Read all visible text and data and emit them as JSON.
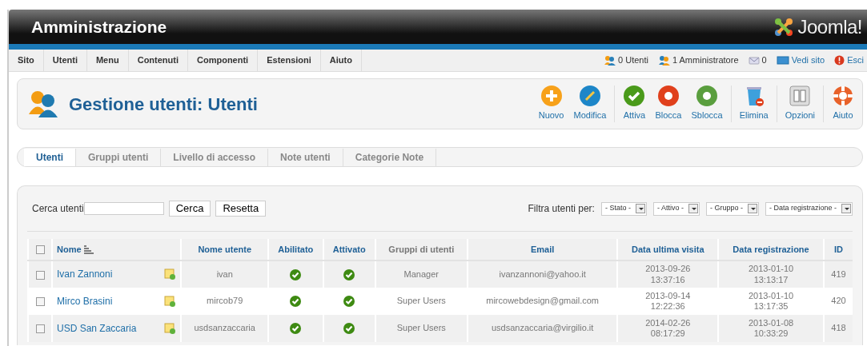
{
  "header": {
    "title": "Amministrazione",
    "logo_text": "Joomla!"
  },
  "menu": [
    "Sito",
    "Utenti",
    "Menu",
    "Contenuti",
    "Componenti",
    "Estensioni",
    "Aiuto"
  ],
  "status": [
    {
      "kind": "users",
      "text": "0 Utenti"
    },
    {
      "kind": "admins",
      "text": "1 Amministratore"
    },
    {
      "kind": "messages",
      "text": "0"
    },
    {
      "kind": "view",
      "text": "Vedi sito"
    },
    {
      "kind": "logout",
      "text": "Esci"
    }
  ],
  "toolbar": {
    "title": "Gestione utenti: Utenti",
    "groups": [
      {
        "buttons": [
          {
            "kind": "new",
            "label": "Nuovo"
          },
          {
            "kind": "edit",
            "label": "Modifica"
          }
        ]
      },
      {
        "buttons": [
          {
            "kind": "activate",
            "label": "Attiva"
          },
          {
            "kind": "block",
            "label": "Blocca"
          },
          {
            "kind": "unblock",
            "label": "Sblocca"
          }
        ]
      },
      {
        "buttons": [
          {
            "kind": "delete",
            "label": "Elimina"
          }
        ]
      },
      {
        "buttons": [
          {
            "kind": "options",
            "label": "Opzioni"
          }
        ]
      },
      {
        "buttons": [
          {
            "kind": "help",
            "label": "Aiuto"
          }
        ]
      }
    ]
  },
  "subtabs": [
    {
      "label": "Utenti",
      "selected": true
    },
    {
      "label": "Gruppi utenti",
      "selected": false
    },
    {
      "label": "Livello di accesso",
      "selected": false
    },
    {
      "label": "Note utenti",
      "selected": false
    },
    {
      "label": "Categorie Note",
      "selected": false
    }
  ],
  "search": {
    "label": "Cerca utenti",
    "buttons": [
      "Cerca",
      "Resetta"
    ]
  },
  "filters": {
    "label": "Filtra utenti per:",
    "selects": [
      "- Stato -",
      "- Attivo -",
      "- Gruppo -",
      "- Data registrazione -"
    ]
  },
  "table": {
    "select_all_checked": false,
    "columns": [
      {
        "label": "Nome",
        "link": true,
        "sorted": true
      },
      {
        "label": "Nome utente",
        "link": true,
        "sorted": false
      },
      {
        "label": "Abilitato",
        "link": true,
        "sorted": false
      },
      {
        "label": "Attivato",
        "link": true,
        "sorted": false
      },
      {
        "label": "Gruppi di utenti",
        "link": false,
        "sorted": false
      },
      {
        "label": "Email",
        "link": true,
        "sorted": false
      },
      {
        "label": "Data ultima visita",
        "link": true,
        "sorted": false
      },
      {
        "label": "Data registrazione",
        "link": true,
        "sorted": false
      },
      {
        "label": "ID",
        "link": true,
        "sorted": false
      }
    ],
    "rows": [
      {
        "checked": false,
        "name": "Ivan Zannoni",
        "username": "ivan",
        "enabled": true,
        "activated": true,
        "groups": "Manager",
        "email": "ivanzannoni@yahoo.it",
        "last_visit": [
          "2013-09-26",
          "13:37:16"
        ],
        "registered": [
          "2013-01-10",
          "13:13:17"
        ],
        "id": "419"
      },
      {
        "checked": false,
        "name": "Mirco Brasini",
        "username": "mircob79",
        "enabled": true,
        "activated": true,
        "groups": "Super Users",
        "email": "mircowebdesign@gmail.com",
        "last_visit": [
          "2013-09-14",
          "12:22:36"
        ],
        "registered": [
          "2013-01-10",
          "13:17:35"
        ],
        "id": "420"
      },
      {
        "checked": false,
        "name": "USD San Zaccaria",
        "username": "usdsanzaccaria",
        "enabled": true,
        "activated": true,
        "groups": "Super Users",
        "email": "usdsanzaccaria@virgilio.it",
        "last_visit": [
          "2014-02-26",
          "08:17:29"
        ],
        "registered": [
          "2013-01-08",
          "10:33:29"
        ],
        "id": "418"
      }
    ]
  }
}
